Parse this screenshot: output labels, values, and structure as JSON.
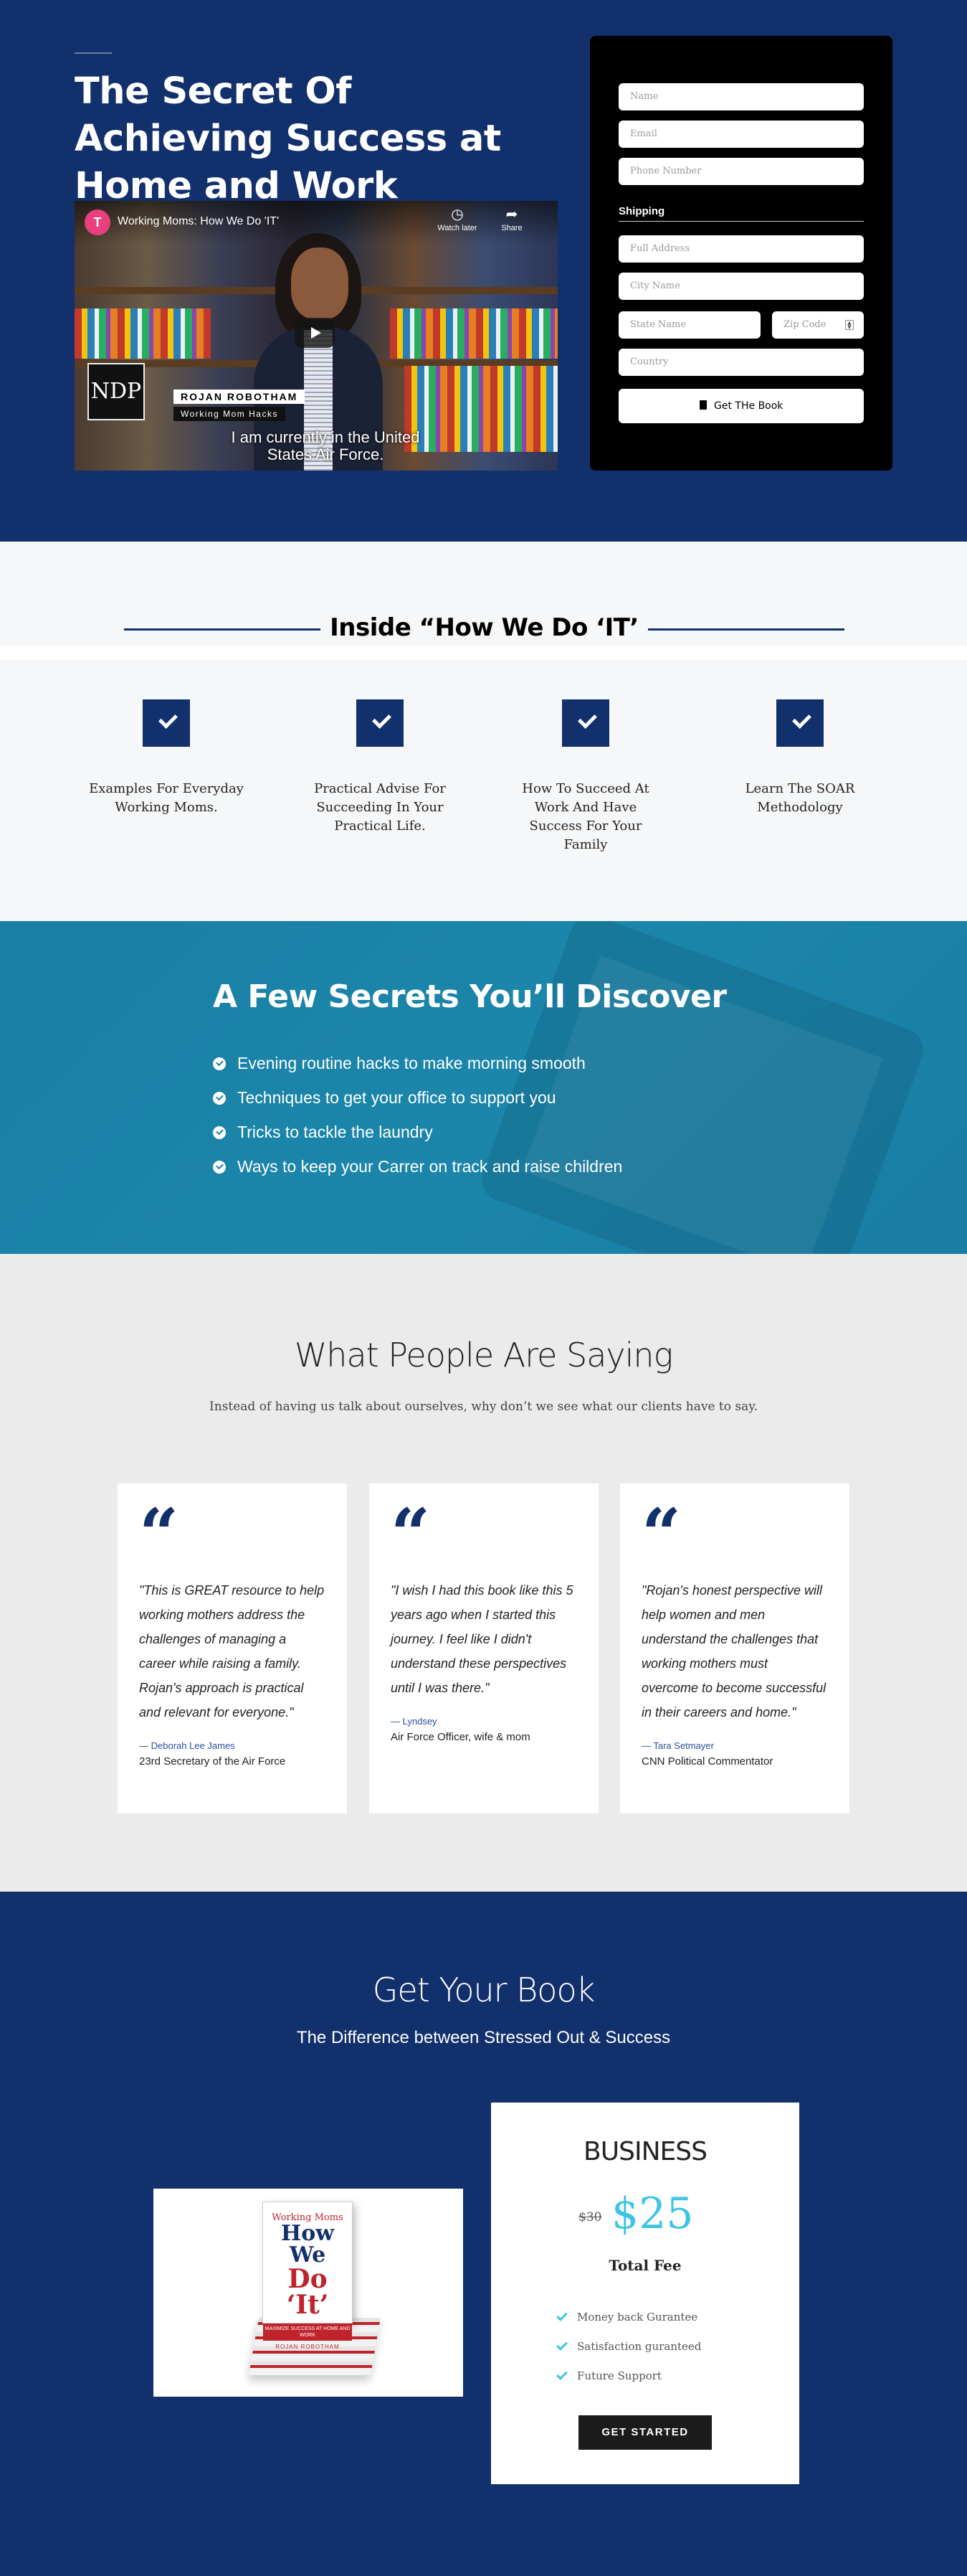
{
  "hero": {
    "title": "The Secret Of Achieving Success at Home and Work",
    "video": {
      "channel_initial": "T",
      "title": "Working Moms: How We Do 'IT'",
      "watch_later": "Watch later",
      "share": "Share",
      "logo_text": "NDP",
      "presenter_name": "ROJAN ROBOTHAM",
      "presenter_subtitle": "Working Mom Hacks",
      "caption": "I am currently in the United States Air Force."
    },
    "form": {
      "name_placeholder": "Name",
      "email_placeholder": "Email",
      "phone_placeholder": "Phone Number",
      "shipping_label": "Shipping",
      "address_placeholder": "Full Address",
      "city_placeholder": "City Name",
      "state_placeholder": "State Name",
      "zip_placeholder": "Zip Code",
      "country_placeholder": "Country",
      "submit_label": "Get THe Book"
    }
  },
  "inside": {
    "title": "Inside “How We Do ‘IT’",
    "features": [
      "Examples For Everyday Working Moms.",
      "Practical Advise For Succeeding In Your Practical Life.",
      "How To Succeed At Work And Have Success For Your Family",
      "Learn The SOAR Methodology"
    ]
  },
  "secrets": {
    "title": "A Few Secrets You’ll Discover",
    "items": [
      "Evening routine hacks to make morning smooth",
      "Techniques to get your office to support you",
      "Tricks to tackle the laundry",
      "Ways to keep your Carrer on track and raise children"
    ]
  },
  "testimonials": {
    "title": "What People Are Saying",
    "subtitle": "Instead of having us talk about ourselves, why don’t we see what our clients have to say.",
    "quote_mark": "“",
    "items": [
      {
        "quote": "\"This is GREAT resource to help working mothers address the challenges of managing a career while raising a family. Rojan's approach is practical and relevant for everyone.\"",
        "name": "— Deborah Lee James",
        "role": "23rd Secretary of the Air Force"
      },
      {
        "quote": "\"I wish I had this book like this 5 years ago when I started this journey. I feel like I didn't understand these perspectives until I was there.\"",
        "name": "— Lyndsey",
        "role": "Air Force Officer, wife & mom"
      },
      {
        "quote": "\"Rojan's honest perspective will help women and men understand the challenges that working mothers must overcome to become successful in their careers and home.\"",
        "name": "— Tara Setmayer",
        "role": "CNN Political Commentator"
      }
    ]
  },
  "book": {
    "title": "Get Your Book",
    "subtitle": "The Difference between Stressed Out & Success",
    "cover": {
      "top": "Working Moms",
      "main": "How We",
      "it": "Do ‘It’",
      "band": "MAXIMIZE SUCCESS AT HOME AND WORK",
      "author": "ROJAN ROBOTHAM"
    },
    "plan": {
      "name": "BUSINESS",
      "old_price": "$30",
      "new_price": "$25",
      "fee_label": "Total Fee",
      "benefits": [
        "Money back Gurantee",
        "Satisfaction guranteed",
        "Future Support"
      ],
      "cta": "GET STARTED"
    }
  },
  "colors": {
    "navy": "#12306b",
    "teal_band": "#1a7fa5",
    "price_accent": "#3ec4e4",
    "form_bg": "#000000",
    "light_bg": "#ebebeb"
  }
}
